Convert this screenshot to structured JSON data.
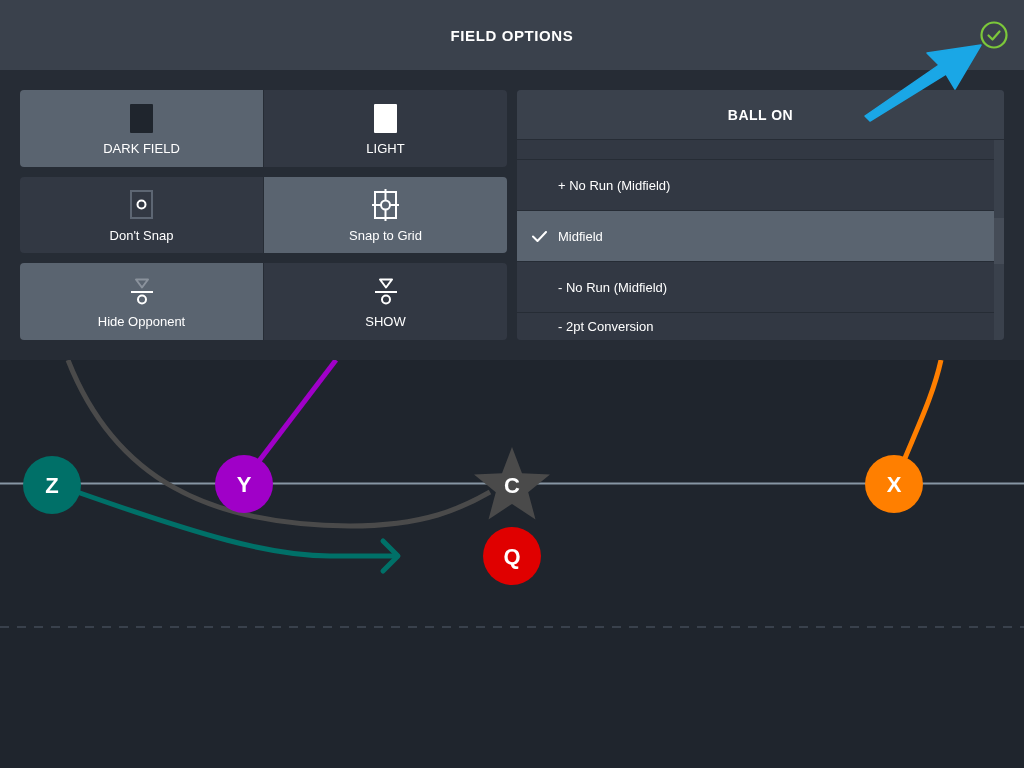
{
  "header": {
    "title": "FIELD OPTIONS"
  },
  "option_groups": [
    {
      "options": [
        {
          "label": "DARK FIELD",
          "kind": "dark",
          "selected": true
        },
        {
          "label": "LIGHT",
          "kind": "light",
          "selected": false
        }
      ]
    },
    {
      "options": [
        {
          "label": "Don't Snap",
          "kind": "no-snap",
          "selected": false
        },
        {
          "label": "Snap to Grid",
          "kind": "snap",
          "selected": true
        }
      ]
    },
    {
      "options": [
        {
          "label": "Hide Opponent",
          "kind": "hide",
          "selected": true
        },
        {
          "label": "SHOW",
          "kind": "show",
          "selected": false
        }
      ]
    }
  ],
  "ball_on": {
    "title": "BALL ON",
    "items": [
      {
        "label": "+ No Run (Midfield)",
        "selected": false
      },
      {
        "label": "Midfield",
        "selected": true
      },
      {
        "label": "- No Run (Midfield)",
        "selected": false
      },
      {
        "label": "- 2pt Conversion",
        "selected": false
      }
    ]
  },
  "formation": {
    "players": [
      {
        "label": "Z",
        "kind": "circle",
        "color": "#007068"
      },
      {
        "label": "Y",
        "kind": "circle",
        "color": "#a000c8"
      },
      {
        "label": "C",
        "kind": "star",
        "color": "#4a4a4a"
      },
      {
        "label": "Q",
        "kind": "circle",
        "color": "#e00000"
      },
      {
        "label": "X",
        "kind": "circle",
        "color": "#ff7f00"
      }
    ]
  }
}
